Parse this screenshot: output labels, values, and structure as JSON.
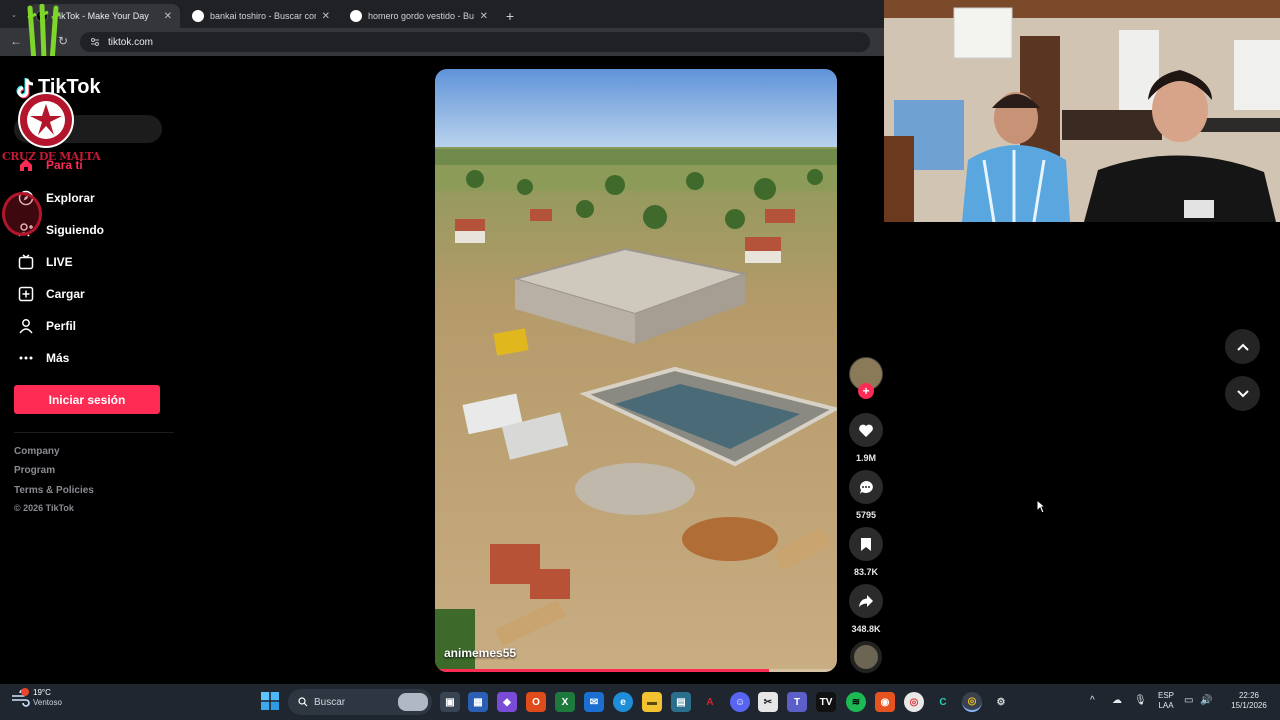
{
  "browser": {
    "tabs": [
      {
        "title": "TikTok - Make Your Day",
        "active": true
      },
      {
        "title": "bankai toshiro - Buscar con Google",
        "active": false
      },
      {
        "title": "homero gordo vestido - Buscar con Google",
        "active": false
      }
    ],
    "url": "tiktok.com"
  },
  "overlay": {
    "logo_text": "CRUZ DE MALTA"
  },
  "sidebar": {
    "brand": "TikTok",
    "items": [
      {
        "label": "Para ti",
        "icon": "home-icon"
      },
      {
        "label": "Explorar",
        "icon": "compass-icon"
      },
      {
        "label": "Siguiendo",
        "icon": "following-icon"
      },
      {
        "label": "LIVE",
        "icon": "live-icon"
      },
      {
        "label": "Cargar",
        "icon": "upload-icon"
      },
      {
        "label": "Perfil",
        "icon": "user-icon"
      },
      {
        "label": "Más",
        "icon": "more-icon"
      }
    ],
    "login_label": "Iniciar sesión",
    "footer": {
      "company": "Company",
      "program": "Program",
      "terms": "Terms & Policies",
      "copyright": "© 2026 TikTok"
    }
  },
  "video": {
    "username": "animemes55",
    "progress_fraction": 0.83,
    "actions": {
      "likes": "1.9M",
      "comments": "5795",
      "saves": "83.7K",
      "shares": "348.8K"
    }
  },
  "taskbar": {
    "weather_temp": "19°C",
    "weather_desc": "Ventoso",
    "search_placeholder": "Buscar",
    "language": "ESP",
    "layout": "LAA",
    "time": "22:26",
    "date": "15/1/2026"
  },
  "colors": {
    "accent": "#fe2c55",
    "browser_dark": "#202124",
    "taskbar": "#1f2630"
  }
}
